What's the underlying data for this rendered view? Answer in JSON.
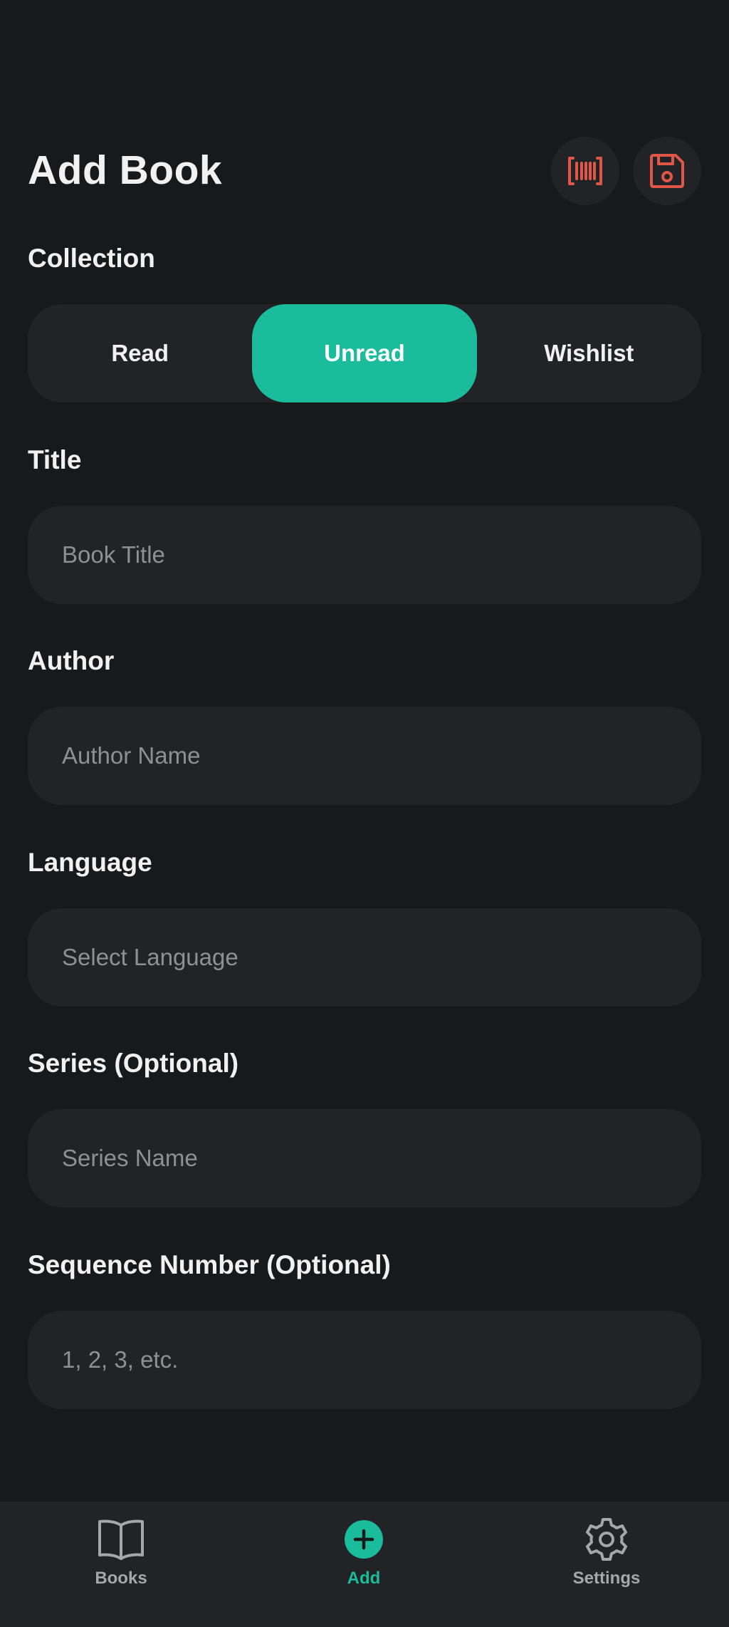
{
  "header": {
    "title": "Add Book"
  },
  "icons": {
    "scan": "barcode-scan-icon",
    "save": "save-icon"
  },
  "colors": {
    "background": "#18191b",
    "surface": "#222326",
    "accent": "#1abc9c",
    "icon_accent": "#e0574a",
    "placeholder": "#8f9092"
  },
  "collection": {
    "label": "Collection",
    "options": [
      "Read",
      "Unread",
      "Wishlist"
    ],
    "selected": "Unread"
  },
  "fields": {
    "title": {
      "label": "Title",
      "placeholder": "Book Title"
    },
    "author": {
      "label": "Author",
      "placeholder": "Author Name"
    },
    "language": {
      "label": "Language",
      "placeholder": "Select Language"
    },
    "series": {
      "label": "Series (Optional)",
      "placeholder": "Series Name"
    },
    "sequence": {
      "label": "Sequence Number (Optional)",
      "placeholder": "1, 2, 3, etc."
    }
  },
  "nav": {
    "items": [
      {
        "label": "Books",
        "icon": "book-icon"
      },
      {
        "label": "Add",
        "icon": "add-icon"
      },
      {
        "label": "Settings",
        "icon": "gear-icon"
      }
    ],
    "active": "Add"
  }
}
